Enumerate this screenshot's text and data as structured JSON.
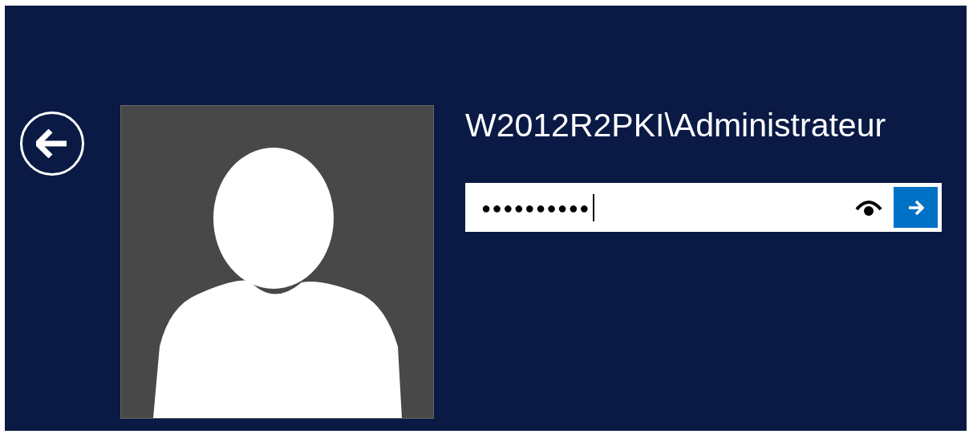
{
  "user": {
    "name": "W2012R2PKI\\Administrateur"
  },
  "password_field": {
    "value": "●●●●●●●●●●",
    "focused": true
  }
}
